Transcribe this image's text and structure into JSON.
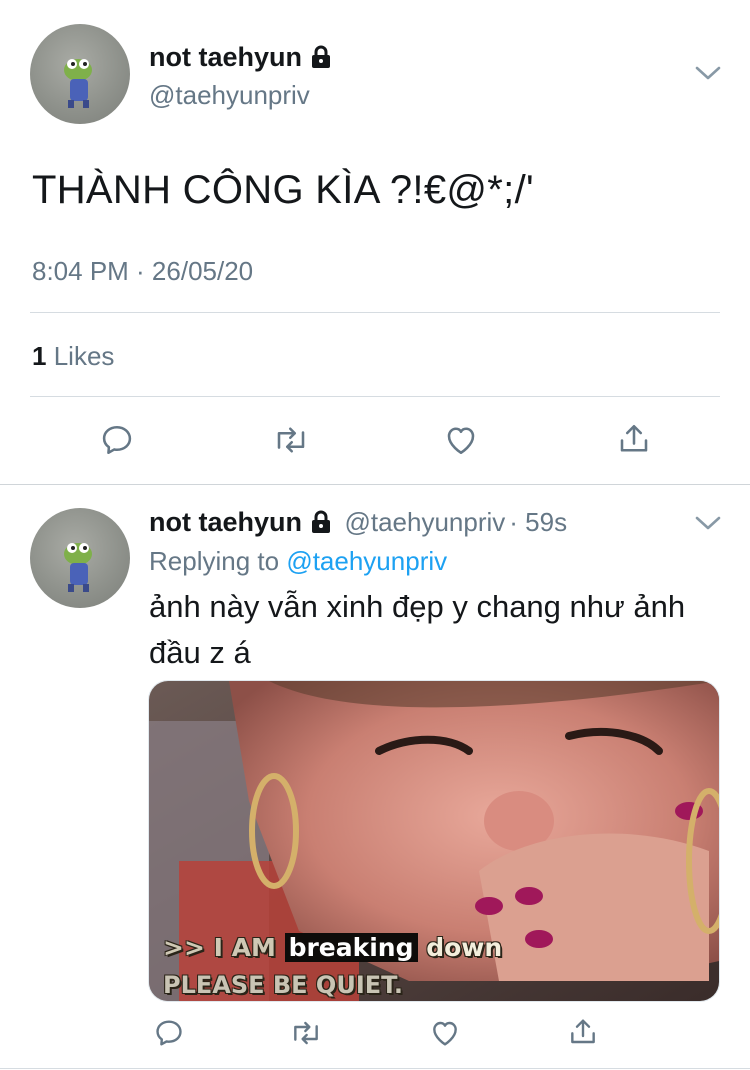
{
  "main_tweet": {
    "author_name": "not taehyun",
    "author_handle": "@taehyunpriv",
    "text": "THÀNH CÔNG KÌA ?!€@*;/'",
    "timestamp": "8:04 PM · 26/05/20",
    "likes_count": "1",
    "likes_label": "Likes"
  },
  "reply_tweet": {
    "author_name": "not taehyun",
    "author_handle": "@taehyunpriv",
    "time_ago": "· 59s",
    "replying_prefix": "Replying to",
    "replying_handle": "@taehyunpriv",
    "text": "ảnh này vẫn xinh đẹp y chang như ảnh đầu z á",
    "media_caption": {
      "line1_prefix": ">> I AM",
      "line1_boxed": "breaking",
      "line1_suffix": "down",
      "line2": "PLEASE BE QUIET."
    }
  },
  "icons": {
    "lock": "lock-icon",
    "chevron": "chevron-down-icon",
    "reply": "reply-icon",
    "retweet": "retweet-icon",
    "like": "heart-icon",
    "share": "share-icon"
  },
  "colors": {
    "text": "#14171a",
    "secondary": "#657786",
    "link": "#1da1f2",
    "divider": "#d6dce1"
  }
}
